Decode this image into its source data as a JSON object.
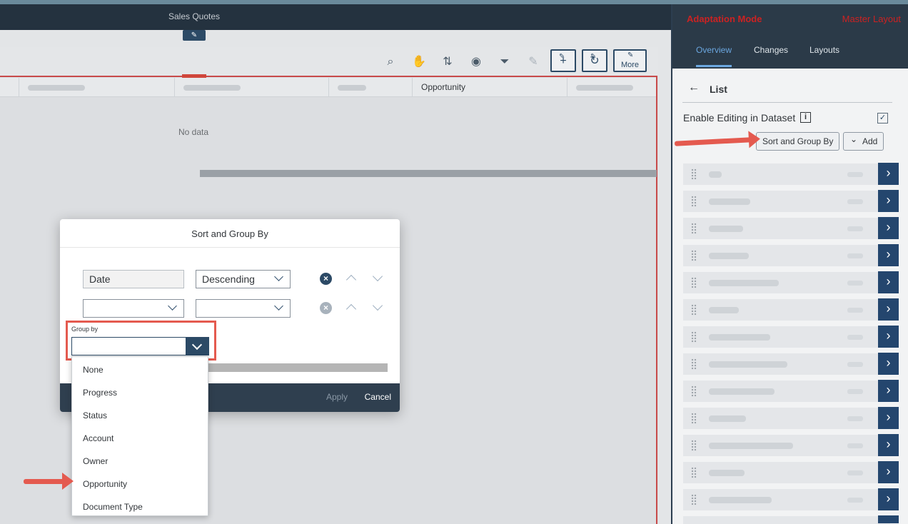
{
  "app": {
    "title": "Sales Quotes",
    "no_data": "No data",
    "table_headers": [
      "",
      "",
      "",
      "Opportunity",
      ""
    ],
    "toolbar_more": "More"
  },
  "dialog": {
    "title": "Sort and Group By",
    "sort_rows": [
      {
        "field": "Date",
        "order": "Descending"
      },
      {
        "field": "",
        "order": ""
      }
    ],
    "group_by_label": "Group by",
    "group_by_value": "",
    "options": [
      "None",
      "Progress",
      "Status",
      "Account",
      "Owner",
      "Opportunity",
      "Document Type"
    ],
    "apply_label": "Apply",
    "cancel_label": "Cancel"
  },
  "panel": {
    "mode": "Adaptation Mode",
    "layout": "Master Layout",
    "tabs": [
      "Overview",
      "Changes",
      "Layouts"
    ],
    "active_tab": "Overview",
    "section": "List",
    "enable_editing": "Enable Editing in Dataset",
    "enable_editing_checked": true,
    "sort_group_button": "Sort and Group By",
    "add_button": "Add"
  },
  "colors": {
    "accent": "#2c4a66",
    "annotation": "#e45a4f",
    "mode_text": "#cc2222"
  }
}
